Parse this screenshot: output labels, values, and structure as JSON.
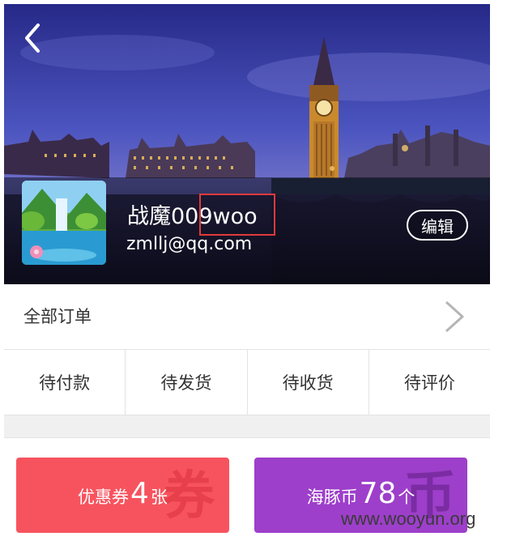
{
  "header": {
    "back_icon": "chevron-left-icon",
    "username": "战魔009woo",
    "email": "zmllj@qq.com",
    "edit_label": "编辑",
    "highlight_color": "#e23a3a"
  },
  "orders": {
    "label": "全部订单",
    "chevron_icon": "chevron-right-icon"
  },
  "tabs": [
    {
      "label": "待付款"
    },
    {
      "label": "待发货"
    },
    {
      "label": "待收货"
    },
    {
      "label": "待评价"
    }
  ],
  "cards": {
    "coupon": {
      "prefix": "优惠券",
      "count": "4",
      "suffix": "张",
      "watermark": "券",
      "color": "#f7535e"
    },
    "coin": {
      "prefix": "海豚币",
      "count": "78",
      "suffix": "个",
      "watermark": "币",
      "color": "#9d3fca"
    }
  },
  "watermark": "www.wooyun.org"
}
